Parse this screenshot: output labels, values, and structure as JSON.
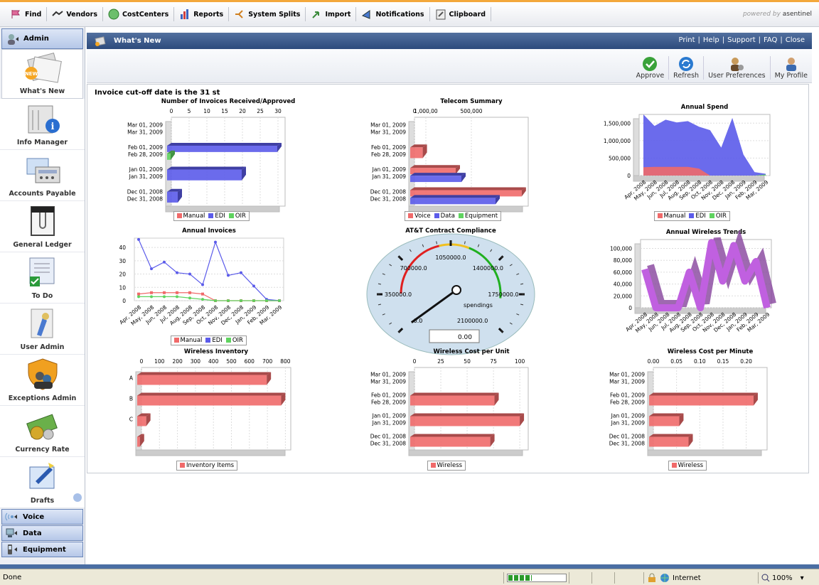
{
  "toolbar": {
    "items": [
      "Find",
      "Vendors",
      "CostCenters",
      "Reports",
      "System Splits",
      "Import",
      "Notifications",
      "Clipboard"
    ],
    "powered_prefix": "powered by",
    "powered_brand": "asentinel"
  },
  "sidebar": {
    "header": "Admin",
    "items": [
      "What's New",
      "Info Manager",
      "Accounts Payable",
      "General Ledger",
      "To Do",
      "User Admin",
      "Exceptions Admin",
      "Currency Rate",
      "Drafts"
    ],
    "bottom": [
      "Voice",
      "Data",
      "Equipment"
    ]
  },
  "panel": {
    "title": "What's New",
    "links": [
      "Print",
      "Help",
      "Support",
      "FAQ",
      "Close"
    ],
    "separator": "|"
  },
  "actions": [
    "Approve",
    "Refresh",
    "User Preferences",
    "My Profile"
  ],
  "content": {
    "cutoff": "Invoice cut-off date is the 31 st"
  },
  "colors": {
    "red": "#f06a6a",
    "blue": "#5b5bea",
    "green": "#5fd35f",
    "purple": "#c060e0"
  },
  "chart_data": [
    {
      "id": "invoices",
      "type": "bar",
      "orientation": "horizontal",
      "title": "Number of Invoices Received/Approved",
      "x_ticks": [
        "0",
        "5",
        "10",
        "15",
        "20",
        "25",
        "30"
      ],
      "xlim": [
        0,
        32
      ],
      "categories": [
        "Mar 01, 2009|Mar 31, 2009",
        "Feb 01, 2009|Feb 28, 2009",
        "Jan 01, 2009|Jan 31, 2009",
        "Dec 01, 2008|Dec 31, 2008"
      ],
      "series": [
        {
          "name": "Manual",
          "values": [
            0,
            0,
            0,
            0
          ]
        },
        {
          "name": "EDI",
          "values": [
            0,
            31,
            21,
            3
          ]
        },
        {
          "name": "OIR",
          "values": [
            0,
            1,
            0,
            0
          ]
        }
      ],
      "legend": [
        "Manual",
        "EDI",
        "OIR"
      ]
    },
    {
      "id": "telecom",
      "type": "bar",
      "orientation": "horizontal",
      "title": "Telecom Summary",
      "x_ticks": [
        "0",
        "500,000",
        "1,000,00"
      ],
      "xlim": [
        0,
        1000000
      ],
      "categories": [
        "Mar 01, 2009|Mar 31, 2009",
        "Feb 01, 2009|Feb 28, 2009",
        "Jan 01, 2009|Jan 31, 2009",
        "Dec 01, 2008|Dec 31, 2008"
      ],
      "series": [
        {
          "name": "Voice",
          "values": [
            0,
            110000,
            400000,
            980000
          ]
        },
        {
          "name": "Data",
          "values": [
            0,
            0,
            450000,
            750000
          ]
        },
        {
          "name": "Equipment",
          "values": [
            0,
            0,
            0,
            0
          ]
        }
      ],
      "legend": [
        "Voice",
        "Data",
        "Equipment"
      ]
    },
    {
      "id": "annual_spend",
      "type": "area",
      "title": "Annual Spend",
      "y_ticks": [
        "1,500,000",
        "1,000,000",
        "500,000",
        "0"
      ],
      "ylim": [
        0,
        1750000
      ],
      "categories": [
        "Apr, 2008",
        "May, 2008",
        "Jun, 2008",
        "Jul, 2008",
        "Aug, 2008",
        "Sep, 2008",
        "Oct, 2008",
        "Nov, 2008",
        "Dec, 2008",
        "Jan, 2009",
        "Feb, 2009",
        "Mar, 2009"
      ],
      "series": [
        {
          "name": "Manual",
          "values": [
            240000,
            250000,
            250000,
            250000,
            250000,
            200000,
            0,
            0,
            0,
            0,
            0,
            0
          ]
        },
        {
          "name": "EDI",
          "values": [
            1750000,
            1420000,
            1600000,
            1520000,
            1560000,
            1400000,
            1300000,
            800000,
            1650000,
            600000,
            100000,
            50000
          ]
        },
        {
          "name": "OIR",
          "values": [
            0,
            0,
            0,
            0,
            0,
            0,
            0,
            0,
            0,
            0,
            0,
            30000
          ]
        }
      ],
      "legend": [
        "Manual",
        "EDI",
        "OIR"
      ]
    },
    {
      "id": "annual_invoices",
      "type": "line",
      "title": "Annual Invoices",
      "y_ticks": [
        "40",
        "30",
        "20",
        "10",
        "0"
      ],
      "ylim": [
        0,
        47
      ],
      "categories": [
        "Apr, 2008",
        "May, 2008",
        "Jun, 2008",
        "Jul, 2008",
        "Aug, 2008",
        "Sep, 2008",
        "Oct, 2008",
        "Nov, 2008",
        "Dec, 2008",
        "Jan, 2009",
        "Feb, 2009",
        "Mar, 2009"
      ],
      "series": [
        {
          "name": "Manual",
          "values": [
            5,
            6,
            6,
            6,
            6,
            5,
            0,
            0,
            0,
            0,
            0,
            0
          ]
        },
        {
          "name": "EDI",
          "values": [
            46,
            24,
            29,
            21,
            20,
            12,
            44,
            19,
            21,
            11,
            1,
            0
          ]
        },
        {
          "name": "OIR",
          "values": [
            3,
            3,
            3,
            3,
            2,
            1,
            0,
            0,
            0,
            0,
            0,
            0
          ]
        }
      ],
      "legend": [
        "Manual",
        "EDI",
        "OIR"
      ]
    },
    {
      "id": "compliance",
      "type": "gauge",
      "title": "AT&T Contract Compliance",
      "ticks": [
        "0.0",
        "350000.0",
        "700000.0",
        "1050000.0",
        "1400000.0",
        "1750000.0",
        "2100000.0"
      ],
      "range": [
        0,
        2100000
      ],
      "value": 0,
      "value_label": "0.00",
      "needle_label": "spendings"
    },
    {
      "id": "wireless_trends",
      "type": "area",
      "title": "Annual Wireless Trends",
      "y_ticks": [
        "100,000",
        "80,000",
        "60,000",
        "40,000",
        "20,000",
        "0"
      ],
      "ylim": [
        0,
        115000
      ],
      "categories": [
        "Apr, 2008",
        "May, 2008",
        "Jun, 2008",
        "Jul, 2008",
        "Aug, 2008",
        "Sep, 2008",
        "Oct, 2008",
        "Nov, 2008",
        "Dec, 2008",
        "Jan, 2009",
        "Feb, 2009",
        "Mar, 2009"
      ],
      "series": [
        {
          "name": "Wireless",
          "values": [
            65000,
            0,
            0,
            0,
            60000,
            0,
            110000,
            45000,
            105000,
            45000,
            78000,
            0
          ]
        }
      ]
    },
    {
      "id": "wireless_inventory",
      "type": "bar",
      "orientation": "horizontal",
      "title": "Wireless Inventory",
      "x_ticks": [
        "0",
        "100",
        "200",
        "300",
        "400",
        "500",
        "600",
        "700",
        "800"
      ],
      "xlim": [
        0,
        830
      ],
      "categories": [
        "A",
        "B",
        "C",
        ""
      ],
      "series": [
        {
          "name": "Inventory Items",
          "values": [
            720,
            800,
            50,
            15
          ]
        }
      ],
      "legend": [
        "Inventory Items"
      ]
    },
    {
      "id": "cost_per_unit",
      "type": "bar",
      "orientation": "horizontal",
      "title": "Wireless Cost per Unit",
      "x_ticks": [
        "0",
        "25",
        "50",
        "75",
        "100"
      ],
      "xlim": [
        0,
        108
      ],
      "categories": [
        "Mar 01, 2009|Mar 31, 2009",
        "Feb 01, 2009|Feb 28, 2009",
        "Jan 01, 2009|Jan 31, 2009",
        "Dec 01, 2008|Dec 31, 2008"
      ],
      "series": [
        {
          "name": "Wireless",
          "values": [
            0,
            80,
            104,
            76
          ]
        }
      ],
      "legend": [
        "Wireless"
      ]
    },
    {
      "id": "cost_per_minute",
      "type": "bar",
      "orientation": "horizontal",
      "title": "Wireless Cost per Minute",
      "x_ticks": [
        "0.00",
        "0.05",
        "0.10",
        "0.15",
        "0.20"
      ],
      "xlim": [
        0,
        0.245
      ],
      "categories": [
        "Mar 01, 2009|Mar 31, 2009",
        "Feb 01, 2009|Feb 28, 2009",
        "Jan 01, 2009|Jan 31, 2009",
        "Dec 01, 2008|Dec 31, 2008"
      ],
      "series": [
        {
          "name": "Wireless",
          "values": [
            0,
            0.225,
            0.065,
            0.085
          ]
        }
      ],
      "legend": [
        "Wireless"
      ]
    }
  ],
  "status": {
    "left": "Done",
    "zone": "Internet",
    "zoom": "100%",
    "progress": 0.4
  }
}
